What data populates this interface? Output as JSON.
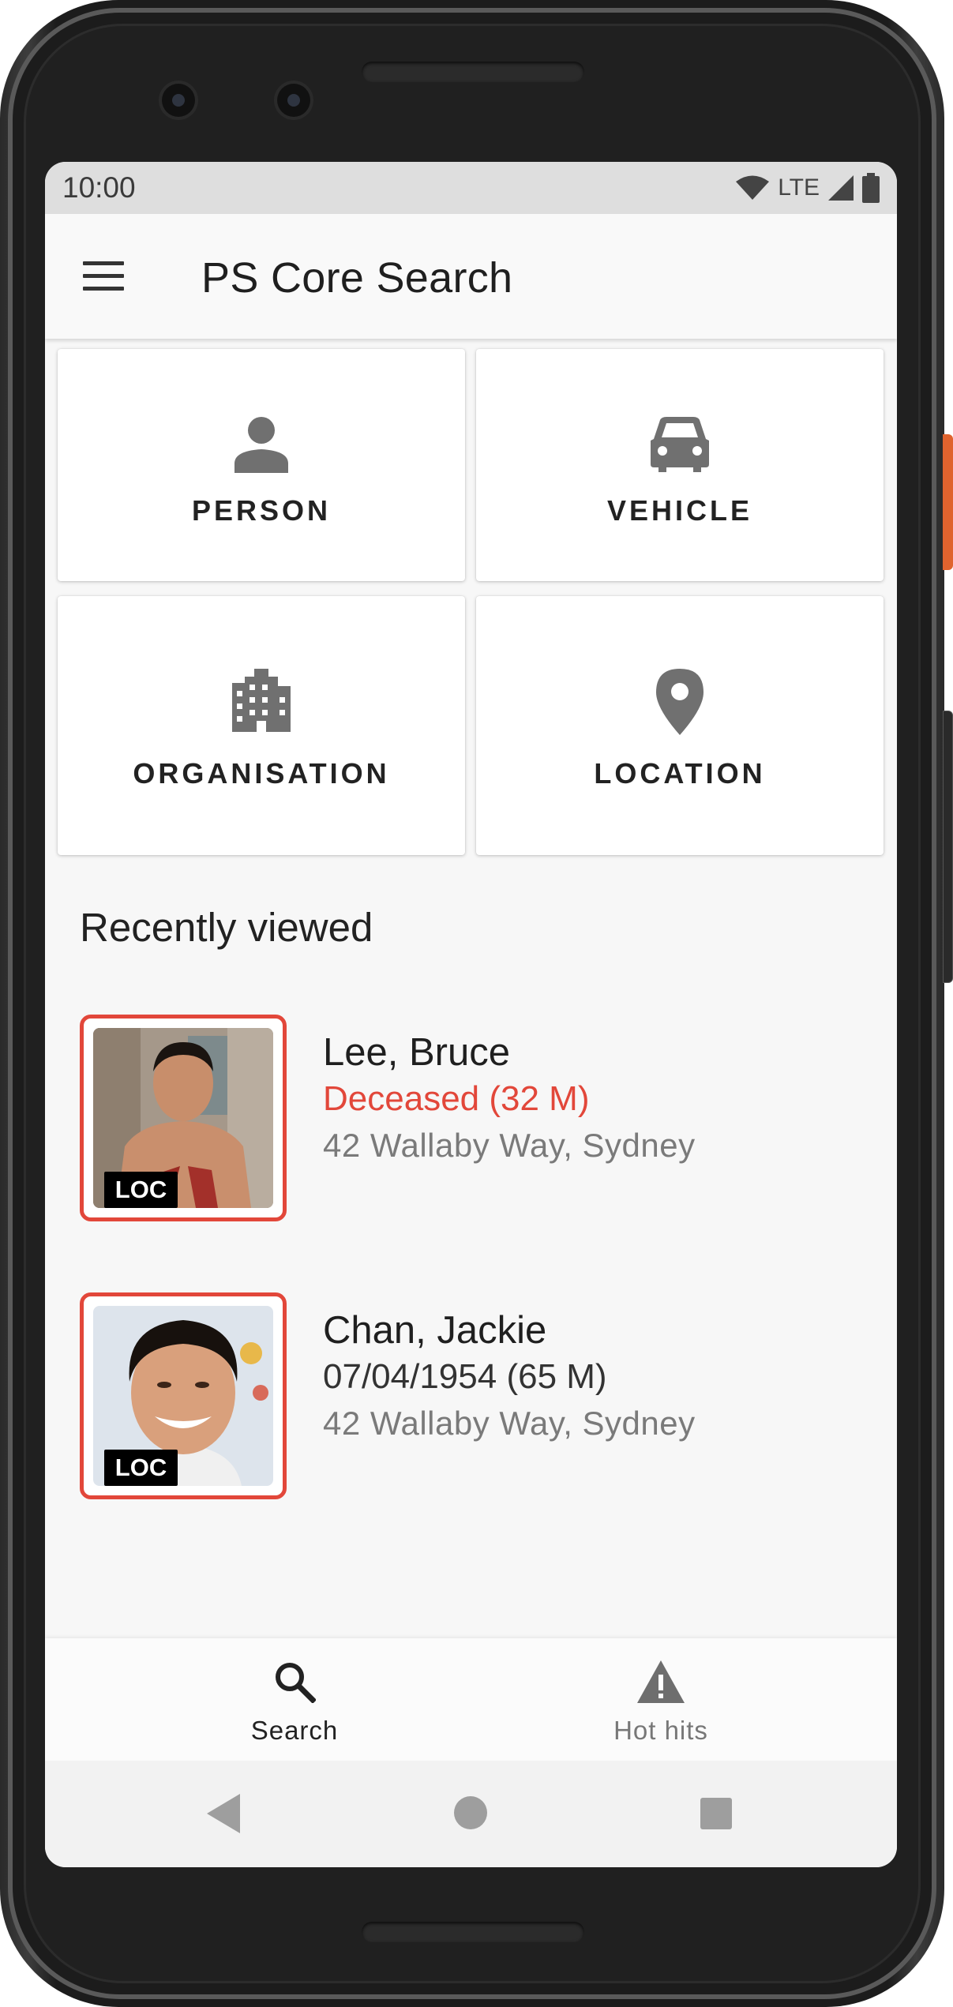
{
  "status_bar": {
    "time": "10:00",
    "network": "LTE",
    "icons": [
      "wifi-icon",
      "signal-icon",
      "battery-icon"
    ]
  },
  "app_bar": {
    "title": "PS Core Search",
    "menu_icon": "menu-icon"
  },
  "categories": [
    {
      "label": "PERSON",
      "icon": "person-icon"
    },
    {
      "label": "VEHICLE",
      "icon": "car-icon"
    },
    {
      "label": "ORGANISATION",
      "icon": "building-icon"
    },
    {
      "label": "LOCATION",
      "icon": "location-pin-icon"
    }
  ],
  "recently_viewed": {
    "title": "Recently viewed",
    "items": [
      {
        "name": "Lee, Bruce",
        "detail": "Deceased (32 M)",
        "address": "42 Wallaby Way, Sydney",
        "tag": "LOC",
        "status_color": "#e2473a"
      },
      {
        "name": "Chan, Jackie",
        "detail": "07/04/1954 (65 M)",
        "address": "42 Wallaby Way, Sydney",
        "tag": "LOC"
      }
    ]
  },
  "bottom_nav": {
    "items": [
      {
        "label": "Search",
        "icon": "search-icon",
        "active": true
      },
      {
        "label": "Hot hits",
        "icon": "warning-icon",
        "active": false
      }
    ]
  },
  "colors": {
    "accent_alert": "#e2473a",
    "icon_gray": "#707070",
    "screen_bg": "#f7f7f7"
  }
}
